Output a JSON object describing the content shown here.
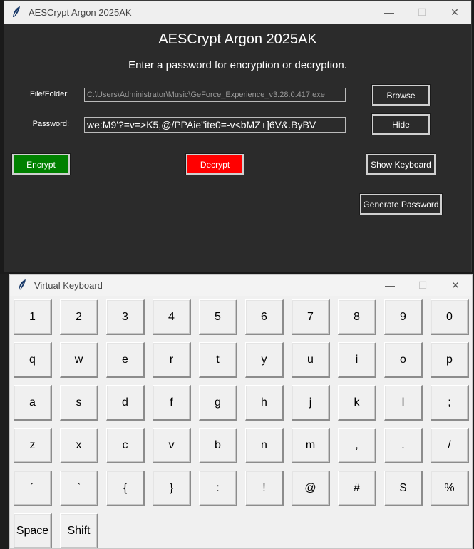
{
  "main_window": {
    "title": "AESCrypt Argon 2025AK",
    "heading": "AESCrypt Argon 2025AK",
    "subtitle": "Enter a password for encryption or decryption.",
    "file_label": "File/Folder:",
    "file_value": "C:\\Users\\Administrator\\Music\\GeForce_Experience_v3.28.0.417.exe",
    "password_label": "Password:",
    "password_value": "we:M9'?=v=>K5,@/PPAie\"ite0=-v<bMZ+]6V&.ByBV",
    "browse_label": "Browse",
    "hide_label": "Hide",
    "encrypt_label": "Encrypt",
    "decrypt_label": "Decrypt",
    "show_keyboard_label": "Show Keyboard",
    "generate_password_label": "Generate Password",
    "colors": {
      "encrypt": "#008000",
      "decrypt": "#ff0000",
      "background": "#2b2b2b"
    }
  },
  "keyboard_window": {
    "title": "Virtual Keyboard",
    "rows": [
      [
        "1",
        "2",
        "3",
        "4",
        "5",
        "6",
        "7",
        "8",
        "9",
        "0"
      ],
      [
        "q",
        "w",
        "e",
        "r",
        "t",
        "y",
        "u",
        "i",
        "o",
        "p"
      ],
      [
        "a",
        "s",
        "d",
        "f",
        "g",
        "h",
        "j",
        "k",
        "l",
        ";"
      ],
      [
        "z",
        "x",
        "c",
        "v",
        "b",
        "n",
        "m",
        ",",
        ".",
        "/"
      ],
      [
        "´",
        "`",
        "{",
        "}",
        ":",
        "!",
        "@",
        "#",
        "$",
        "%"
      ],
      [
        "Space",
        "Shift"
      ]
    ]
  },
  "icons": {
    "app": "feather-icon",
    "minimize": "minimize-icon",
    "maximize": "maximize-icon",
    "close": "close-icon"
  }
}
